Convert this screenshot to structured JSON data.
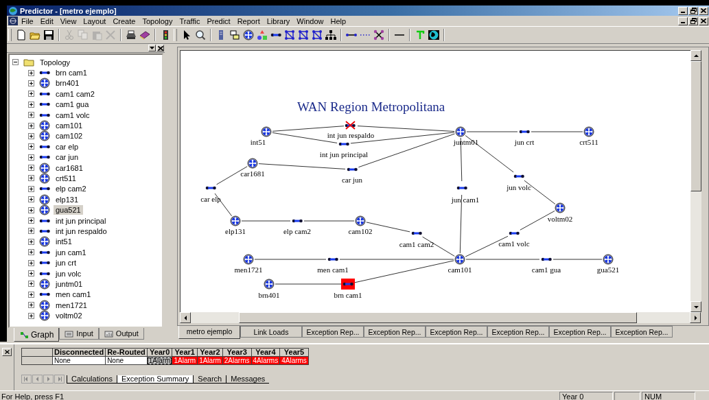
{
  "window": {
    "title": "Predictor - [metro ejemplo]"
  },
  "menu": [
    "File",
    "Edit",
    "View",
    "Layout",
    "Create",
    "Topology",
    "Traffic",
    "Predict",
    "Report",
    "Library",
    "Window",
    "Help"
  ],
  "toolbar": [
    {
      "kind": "new",
      "disabled": false
    },
    {
      "kind": "open",
      "disabled": false
    },
    {
      "kind": "save",
      "disabled": false
    },
    {
      "kind": "sep"
    },
    {
      "kind": "cut",
      "disabled": true
    },
    {
      "kind": "copy",
      "disabled": true
    },
    {
      "kind": "paste",
      "disabled": true
    },
    {
      "kind": "delete",
      "disabled": true
    },
    {
      "kind": "sep"
    },
    {
      "kind": "print",
      "disabled": false
    },
    {
      "kind": "book",
      "disabled": false
    },
    {
      "kind": "sep"
    },
    {
      "kind": "light",
      "disabled": false
    },
    {
      "kind": "grip"
    },
    {
      "kind": "pointer",
      "disabled": false
    },
    {
      "kind": "zoom",
      "disabled": false
    },
    {
      "kind": "sep"
    },
    {
      "kind": "server",
      "disabled": false
    },
    {
      "kind": "devices",
      "disabled": false
    },
    {
      "kind": "router",
      "disabled": false
    },
    {
      "kind": "shapes",
      "disabled": false
    },
    {
      "kind": "link",
      "disabled": false
    },
    {
      "kind": "mesh",
      "disabled": false
    },
    {
      "kind": "mesh",
      "disabled": false
    },
    {
      "kind": "mesh",
      "disabled": false
    },
    {
      "kind": "tree",
      "disabled": false
    },
    {
      "kind": "sep"
    },
    {
      "kind": "line",
      "disabled": false
    },
    {
      "kind": "dots",
      "disabled": false
    },
    {
      "kind": "cross",
      "disabled": false
    },
    {
      "kind": "sep"
    },
    {
      "kind": "dash",
      "disabled": false
    },
    {
      "kind": "sep"
    },
    {
      "kind": "text",
      "disabled": false
    },
    {
      "kind": "globe",
      "disabled": false
    }
  ],
  "tree": {
    "label": "Topology",
    "expanded": true,
    "children": [
      {
        "kind": "link",
        "label": "brn cam1",
        "selected": false
      },
      {
        "kind": "router",
        "label": "brn401",
        "selected": false
      },
      {
        "kind": "link",
        "label": "cam1 cam2",
        "selected": false
      },
      {
        "kind": "link",
        "label": "cam1 gua",
        "selected": false
      },
      {
        "kind": "link",
        "label": "cam1 volc",
        "selected": false
      },
      {
        "kind": "router",
        "label": "cam101",
        "selected": false
      },
      {
        "kind": "router",
        "label": "cam102",
        "selected": false
      },
      {
        "kind": "link",
        "label": "car elp",
        "selected": false
      },
      {
        "kind": "link",
        "label": "car jun",
        "selected": false
      },
      {
        "kind": "router",
        "label": "car1681",
        "selected": false
      },
      {
        "kind": "router",
        "label": "crt511",
        "selected": false
      },
      {
        "kind": "link",
        "label": "elp cam2",
        "selected": false
      },
      {
        "kind": "router",
        "label": "elp131",
        "selected": false
      },
      {
        "kind": "router",
        "label": "gua521",
        "selected": true
      },
      {
        "kind": "link",
        "label": "int jun principal",
        "selected": false
      },
      {
        "kind": "link",
        "label": "int jun respaldo",
        "selected": false
      },
      {
        "kind": "router",
        "label": "int51",
        "selected": false
      },
      {
        "kind": "link",
        "label": "jun cam1",
        "selected": false
      },
      {
        "kind": "link",
        "label": "jun crt",
        "selected": false
      },
      {
        "kind": "link",
        "label": "jun volc",
        "selected": false
      },
      {
        "kind": "router",
        "label": "juntm01",
        "selected": false
      },
      {
        "kind": "link",
        "label": "men cam1",
        "selected": false
      },
      {
        "kind": "router",
        "label": "men1721",
        "selected": false
      },
      {
        "kind": "router",
        "label": "voltm02",
        "selected": false
      }
    ]
  },
  "left_tabs": [
    {
      "label": "Graph",
      "selected": true
    },
    {
      "label": "Input",
      "selected": false
    },
    {
      "label": "Output",
      "selected": false
    }
  ],
  "diagram": {
    "title": "WAN Region Metropolitana",
    "nodes": [
      {
        "kind": "router",
        "label": "int51",
        "failed": false,
        "alarm": false
      },
      {
        "kind": "link",
        "label": "int jun respaldo",
        "failed": true,
        "alarm": false
      },
      {
        "kind": "link",
        "label": "int jun principal",
        "failed": false,
        "alarm": false
      },
      {
        "kind": "router",
        "label": "juntm01",
        "failed": false,
        "alarm": false
      },
      {
        "kind": "link",
        "label": "jun crt",
        "failed": false,
        "alarm": false
      },
      {
        "kind": "router",
        "label": "crt511",
        "failed": false,
        "alarm": false
      },
      {
        "kind": "router",
        "label": "car1681",
        "failed": false,
        "alarm": false
      },
      {
        "kind": "link",
        "label": "car jun",
        "failed": false,
        "alarm": false
      },
      {
        "kind": "link",
        "label": "car elp",
        "failed": false,
        "alarm": false
      },
      {
        "kind": "link",
        "label": "jun cam1",
        "failed": false,
        "alarm": false
      },
      {
        "kind": "link",
        "label": "jun volc",
        "failed": false,
        "alarm": false
      },
      {
        "kind": "router",
        "label": "voltm02",
        "failed": false,
        "alarm": false
      },
      {
        "kind": "router",
        "label": "elp131",
        "failed": false,
        "alarm": false
      },
      {
        "kind": "link",
        "label": "elp cam2",
        "failed": false,
        "alarm": false
      },
      {
        "kind": "router",
        "label": "cam102",
        "failed": false,
        "alarm": false
      },
      {
        "kind": "link",
        "label": "cam1 cam2",
        "failed": false,
        "alarm": false
      },
      {
        "kind": "link",
        "label": "cam1 volc",
        "failed": false,
        "alarm": false
      },
      {
        "kind": "router",
        "label": "men1721",
        "failed": false,
        "alarm": false
      },
      {
        "kind": "link",
        "label": "men cam1",
        "failed": false,
        "alarm": false
      },
      {
        "kind": "router",
        "label": "cam101",
        "failed": false,
        "alarm": false
      },
      {
        "kind": "link",
        "label": "cam1 gua",
        "failed": false,
        "alarm": false
      },
      {
        "kind": "router",
        "label": "gua521",
        "failed": false,
        "alarm": false
      },
      {
        "kind": "router",
        "label": "brn401",
        "failed": false,
        "alarm": false
      },
      {
        "kind": "link",
        "label": "brn cam1",
        "failed": false,
        "alarm": true
      }
    ]
  },
  "view_tabs": [
    {
      "label": "metro ejemplo",
      "selected": true
    },
    {
      "label": "Link Loads",
      "selected": false
    },
    {
      "label": "Exception Rep...",
      "selected": false
    },
    {
      "label": "Exception Rep...",
      "selected": false
    },
    {
      "label": "Exception Rep...",
      "selected": false
    },
    {
      "label": "Exception Rep...",
      "selected": false
    },
    {
      "label": "Exception Rep...",
      "selected": false
    },
    {
      "label": "Exception Rep...",
      "selected": false
    }
  ],
  "grid": {
    "columns": [
      "Disconnected",
      "Re-Routed",
      "Year0",
      "Year1",
      "Year2",
      "Year3",
      "Year4",
      "Year5"
    ],
    "rows": [
      [
        {
          "text": "None",
          "alarm": false,
          "selected": false
        },
        {
          "text": "None",
          "alarm": false,
          "selected": false
        },
        {
          "text": "1Alarm",
          "alarm": false,
          "selected": true
        },
        {
          "text": "1Alarm",
          "alarm": true,
          "selected": false
        },
        {
          "text": "1Alarm",
          "alarm": true,
          "selected": false
        },
        {
          "text": "2Alarms",
          "alarm": true,
          "selected": false
        },
        {
          "text": "4Alarms",
          "alarm": true,
          "selected": false
        },
        {
          "text": "4Alarms",
          "alarm": true,
          "selected": false
        }
      ]
    ]
  },
  "sheet_tabs": [
    {
      "label": "Calculations",
      "selected": false
    },
    {
      "label": "Exception Summary",
      "selected": true
    },
    {
      "label": "Search",
      "selected": false
    },
    {
      "label": "Messages",
      "selected": false
    }
  ],
  "status_bar": [
    "For Help, press F1",
    "Year 0",
    "NUM"
  ]
}
